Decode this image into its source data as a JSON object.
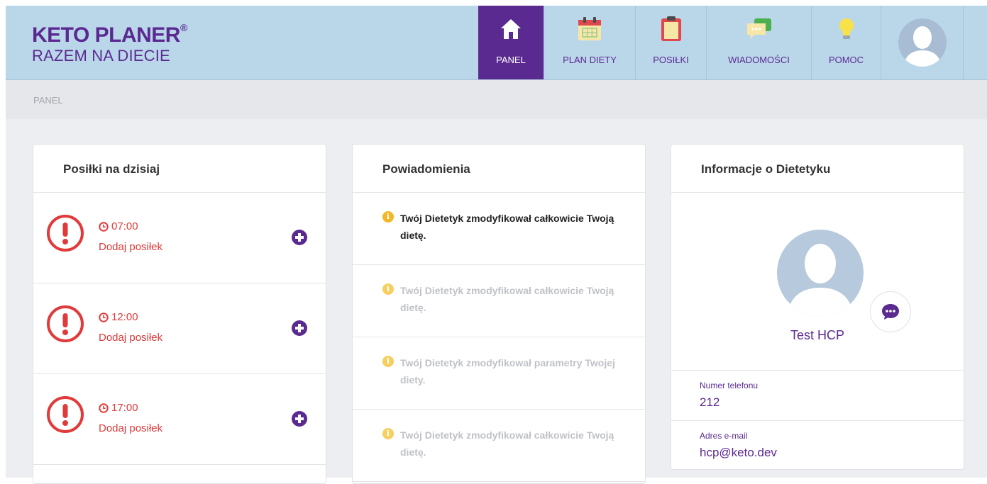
{
  "brand": {
    "title": "KETO PLANER",
    "mark": "®",
    "subtitle": "RAZEM NA DIECIE"
  },
  "nav": [
    {
      "label": "PANEL",
      "icon": "home-icon",
      "active": true
    },
    {
      "label": "PLAN DIETY",
      "icon": "calendar-icon",
      "active": false
    },
    {
      "label": "POSIŁKI",
      "icon": "clipboard-icon",
      "active": false
    },
    {
      "label": "WIADOMOŚCI",
      "icon": "chat-icon",
      "active": false
    },
    {
      "label": "POMOC",
      "icon": "lightbulb-icon",
      "active": false
    }
  ],
  "breadcrumb": "PANEL",
  "meals_card": {
    "title": "Posiłki na dzisiaj",
    "items": [
      {
        "time": "07:00",
        "action": "Dodaj posiłek"
      },
      {
        "time": "12:00",
        "action": "Dodaj posiłek"
      },
      {
        "time": "17:00",
        "action": "Dodaj posiłek"
      }
    ]
  },
  "notifications_card": {
    "title": "Powiadomienia",
    "items": [
      {
        "text": "Twój Dietetyk zmodyfikował całkowicie Twoją dietę.",
        "read": false
      },
      {
        "text": "Twój Dietetyk zmodyfikował całkowicie Twoją dietę.",
        "read": true
      },
      {
        "text": "Twój Dietetyk zmodyfikował parametry Twojej diety.",
        "read": true
      },
      {
        "text": "Twój Dietetyk zmodyfikował całkowicie Twoją dietę.",
        "read": true
      }
    ]
  },
  "dietitian_card": {
    "title": "Informacje o Dietetyku",
    "name": "Test HCP",
    "phone_label": "Numer telefonu",
    "phone": "212",
    "email_label": "Adres e-mail",
    "email": "hcp@keto.dev"
  },
  "colors": {
    "brand": "#5b2a91",
    "header_bg": "#bad7ea",
    "alert": "#e03a3a",
    "info": "#f3b723"
  }
}
